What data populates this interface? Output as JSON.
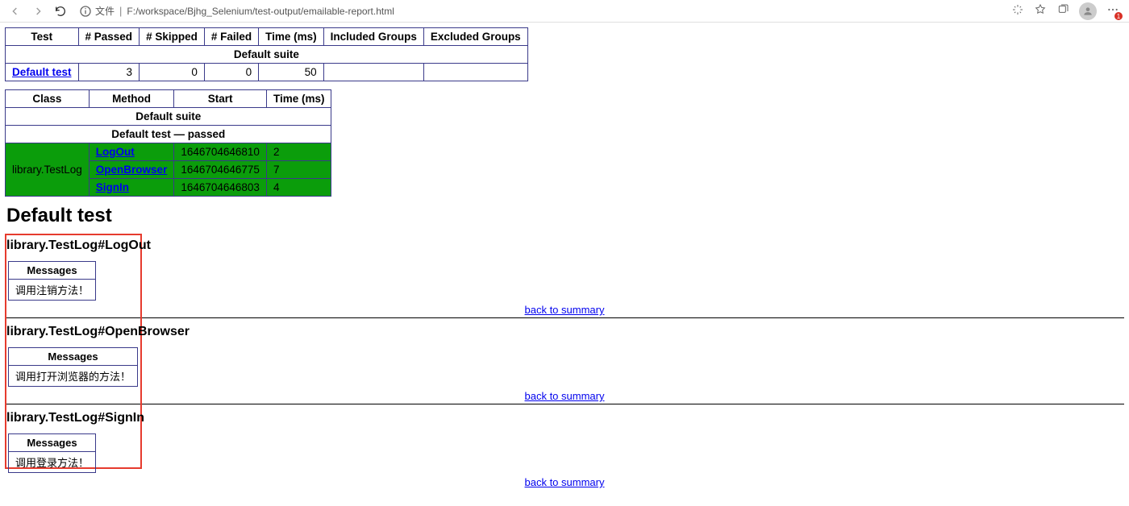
{
  "browser": {
    "url": "F:/workspace/Bjhg_Selenium/test-output/emailable-report.html",
    "file_label": "文件",
    "dots_badge": "1"
  },
  "summary": {
    "headers": {
      "test": "Test",
      "passed": "# Passed",
      "skipped": "# Skipped",
      "failed": "# Failed",
      "time": "Time (ms)",
      "included": "Included Groups",
      "excluded": "Excluded Groups"
    },
    "suite_label": "Default suite",
    "row": {
      "name": "Default test",
      "passed": "3",
      "skipped": "0",
      "failed": "0",
      "time": "50",
      "included": "",
      "excluded": ""
    }
  },
  "methods": {
    "headers": {
      "class": "Class",
      "method": "Method",
      "start": "Start",
      "time": "Time (ms)"
    },
    "suite_label": "Default suite",
    "test_label": "Default test — passed",
    "class_name": "library.TestLog",
    "rows": [
      {
        "method": "LogOut",
        "start": "1646704646810",
        "time": "2"
      },
      {
        "method": "OpenBrowser",
        "start": "1646704646775",
        "time": "7"
      },
      {
        "method": "SignIn",
        "start": "1646704646803",
        "time": "4"
      }
    ]
  },
  "details": {
    "title": "Default test",
    "messages_header": "Messages",
    "back_label": "back to summary",
    "sections": [
      {
        "heading": "library.TestLog#LogOut",
        "message": "调用注销方法！"
      },
      {
        "heading": "library.TestLog#OpenBrowser",
        "message": "调用打开浏览器的方法！"
      },
      {
        "heading": "library.TestLog#SignIn",
        "message": "调用登录方法！"
      }
    ]
  }
}
